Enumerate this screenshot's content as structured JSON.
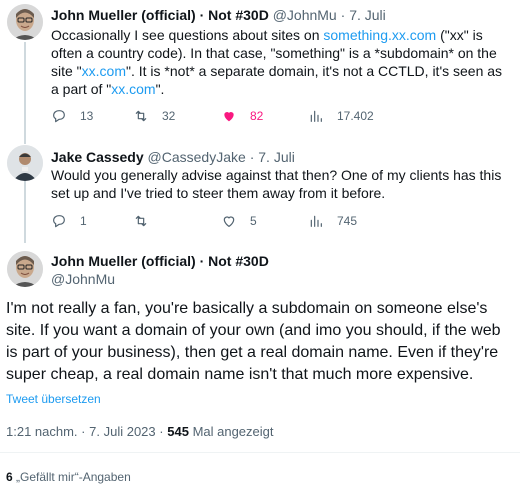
{
  "tweets": [
    {
      "name": "John Mueller (official) · Not #30D",
      "handle": "@JohnMu",
      "separator": "·",
      "date": "7. Juli",
      "text_parts": {
        "p1": "Occasionally I see questions about sites on ",
        "link1": "something.xx.com",
        "p2": " (\"xx\" is often a country code). In that case, \"something\" is a *subdomain* on the site \"",
        "link2": "xx.com",
        "p3": "\". It is *not* a separate domain, it's not a CCTLD, it's seen as a part of \"",
        "link3": "xx.com",
        "p4": "\"."
      },
      "replies": "13",
      "retweets": "32",
      "likes": "82",
      "views": "17.402",
      "liked": true
    },
    {
      "name": "Jake Cassedy",
      "handle": "@CassedyJake",
      "separator": "·",
      "date": "7. Juli",
      "text": "Would you generally advise against that then? One of my clients has this set up and I've tried to steer them away from it before.",
      "replies": "1",
      "retweets": "",
      "likes": "5",
      "views": "745",
      "liked": false
    }
  ],
  "main_tweet": {
    "name": "John Mueller (official) · Not #30D",
    "handle": "@JohnMu",
    "text": "I'm not really a fan, you're basically a subdomain on someone else's site. If you want a domain of your own (and imo you should, if the web is part of your business), then get a real domain name. Even if they're super cheap, a real domain name isn't that much more expensive.",
    "translate_label": "Tweet übersetzen",
    "time": "1:21 nachm.",
    "dot": "·",
    "date": "7. Juli 2023",
    "views_number": "545",
    "views_label": "Mal angezeigt",
    "likes_number": "6",
    "likes_label": "„Gefällt mir“-Angaben"
  },
  "colors": {
    "accent": "#1d9bf0",
    "like": "#f91880",
    "secondary_text": "#536471",
    "primary_text": "#0f1419"
  },
  "icons": [
    "reply-icon",
    "retweet-icon",
    "like-icon",
    "views-icon"
  ]
}
